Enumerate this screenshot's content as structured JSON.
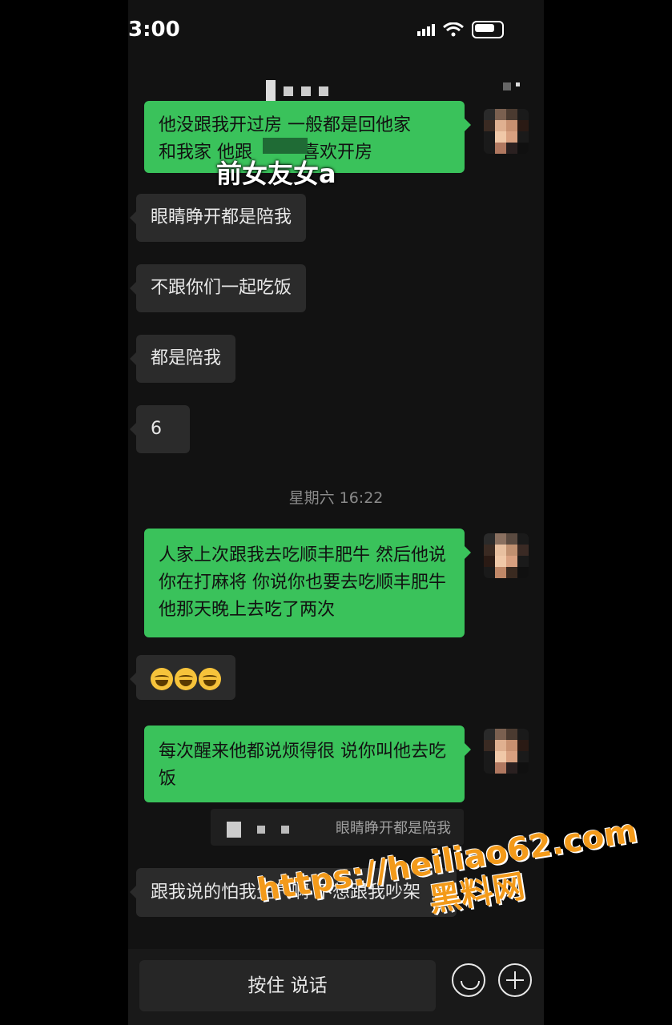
{
  "status_bar": {
    "time": "3:00"
  },
  "chat": {
    "messages": [
      {
        "id": "m1",
        "side": "out",
        "text_line1": "他没跟我开过房 一般都是回他家",
        "text_line2_a": "和我家 他跟",
        "text_line2_b": "喜欢开房"
      },
      {
        "id": "m2",
        "side": "in",
        "text": "眼睛睁开都是陪我"
      },
      {
        "id": "m3",
        "side": "in",
        "text": "不跟你们一起吃饭"
      },
      {
        "id": "m4",
        "side": "in",
        "text": "都是陪我"
      },
      {
        "id": "m5",
        "side": "in",
        "text": "6"
      },
      {
        "id": "m6",
        "side": "out",
        "text": "人家上次跟我去吃顺丰肥牛 然后他说你在打麻将 你说你也要去吃顺丰肥牛 他那天晚上去吃了两次"
      },
      {
        "id": "m7",
        "side": "in",
        "emoji": "laughing-tears-emoji x3"
      },
      {
        "id": "m8",
        "side": "out",
        "text": "每次醒来他都说烦得很 说你叫他去吃饭"
      },
      {
        "id": "m9",
        "side": "in",
        "text": "跟我说的怕我生气啊 不想跟我吵架"
      }
    ],
    "timestamp": "星期六 16:22",
    "quote_text": "眼睛睁开都是陪我"
  },
  "overlay_label": "前女友女a",
  "input_bar": {
    "voice_label": "按住 说话"
  },
  "watermark": {
    "line1": "https://heiliao62.com",
    "line2": "黑料网"
  }
}
